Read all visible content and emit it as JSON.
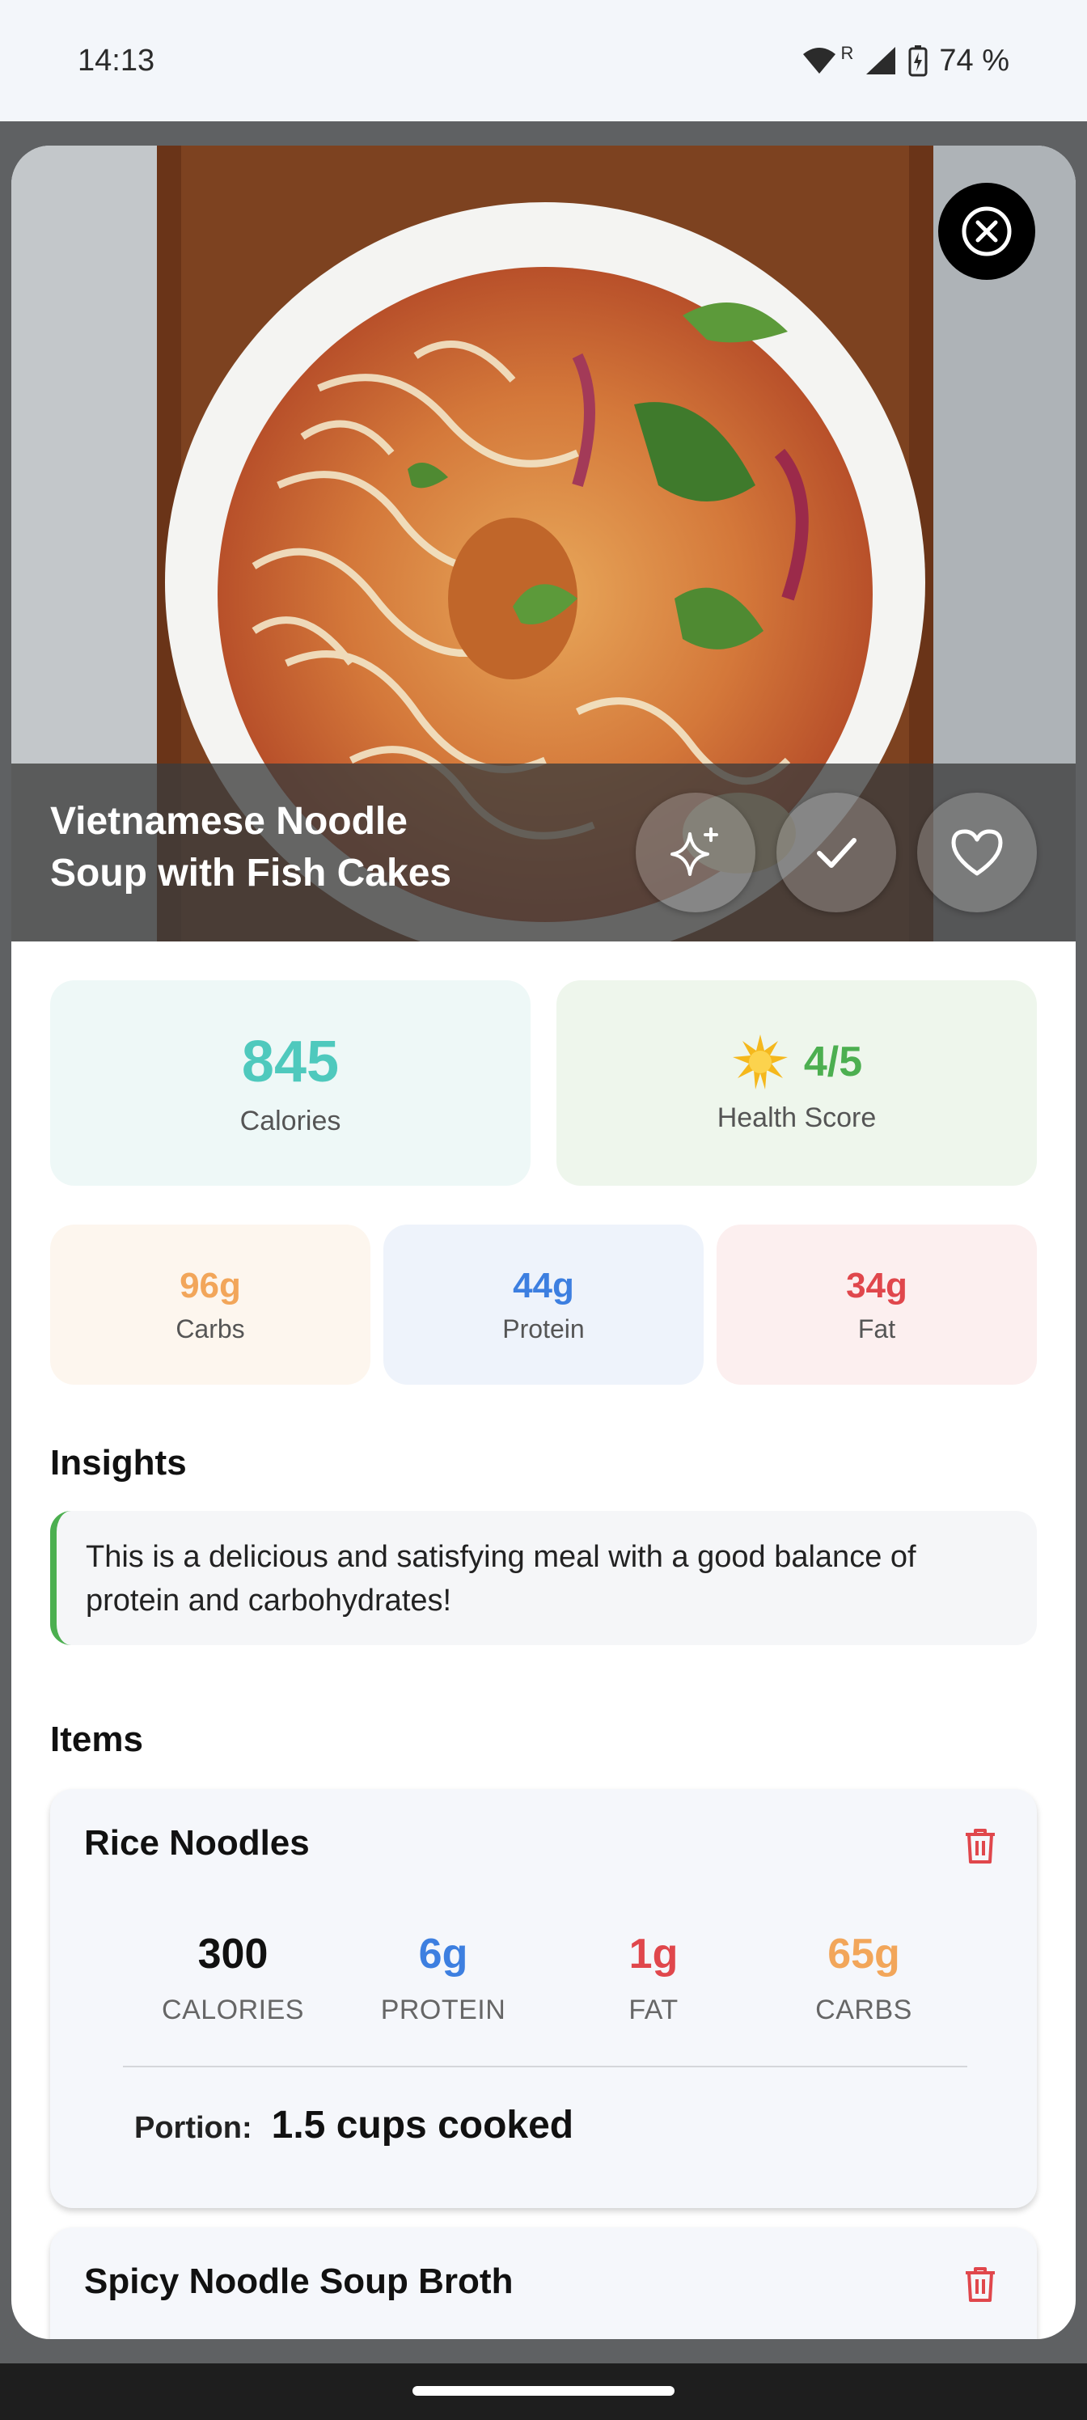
{
  "status_bar": {
    "time": "14:13",
    "roaming": "R",
    "battery": "74 %"
  },
  "meal": {
    "title": "Vietnamese Noodle Soup with Fish Cakes",
    "calories": {
      "value": "845",
      "label": "Calories"
    },
    "health": {
      "icon": "sun-star",
      "value": "4/5",
      "label": "Health Score"
    },
    "macros": [
      {
        "value": "96g",
        "label": "Carbs",
        "color": "#f2a65a"
      },
      {
        "value": "44g",
        "label": "Protein",
        "color": "#3d7fe0"
      },
      {
        "value": "34g",
        "label": "Fat",
        "color": "#e0474c"
      }
    ]
  },
  "actions": {
    "icons": [
      "sparkles-icon",
      "check-icon",
      "heart-icon",
      "close-icon"
    ]
  },
  "insights": {
    "title": "Insights",
    "text": "This is a delicious and satisfying meal with a good balance of protein and carbohydrates!"
  },
  "items": {
    "title": "Items",
    "list": [
      {
        "name": "Rice Noodles",
        "calories": "300",
        "calories_label": "CALORIES",
        "protein": "6g",
        "protein_label": "PROTEIN",
        "fat": "1g",
        "fat_label": "FAT",
        "carbs": "65g",
        "carbs_label": "CARBS",
        "portion_label": "Portion:",
        "portion": "1.5 cups cooked"
      },
      {
        "name": "Spicy Noodle Soup Broth"
      }
    ]
  },
  "colors": {
    "accent_calories": "#4fc9bd",
    "accent_health": "#4caf50",
    "trash": "#e0474c"
  }
}
